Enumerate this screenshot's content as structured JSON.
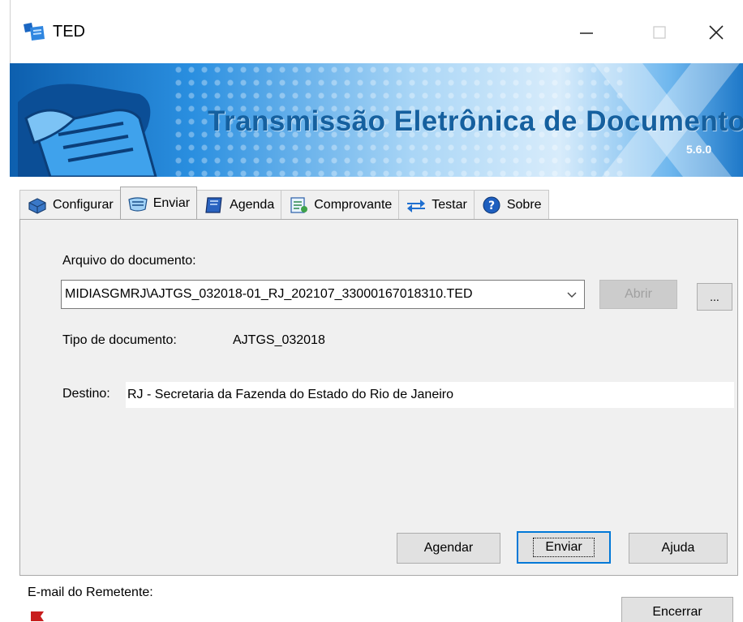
{
  "window": {
    "title": "TED",
    "icon": "ted-app-icon",
    "controls": [
      "minimize-icon",
      "maximize-icon",
      "close-icon"
    ]
  },
  "banner": {
    "title": "Transmissão Eletrônica de Documentos",
    "version": "5.6.0"
  },
  "tabs": [
    {
      "label": "Configurar",
      "icon": "configure-icon",
      "active": false
    },
    {
      "label": "Enviar",
      "icon": "send-icon",
      "active": true
    },
    {
      "label": "Agenda",
      "icon": "agenda-book-icon",
      "active": false
    },
    {
      "label": "Comprovante",
      "icon": "receipt-icon",
      "active": false
    },
    {
      "label": "Testar",
      "icon": "test-arrows-icon",
      "active": false
    },
    {
      "label": "Sobre",
      "icon": "help-icon",
      "active": false
    }
  ],
  "enviar": {
    "file_label": "Arquivo do documento:",
    "file_value": "MIDIASGMRJ\\AJTGS_032018-01_RJ_202107_33000167018310.TED",
    "open_button": "Abrir",
    "browse_button": "...",
    "doc_type_label": "Tipo de documento:",
    "doc_type_value": "AJTGS_032018",
    "destination_label": "Destino:",
    "destination_value": "RJ - Secretaria da Fazenda do Estado do Rio de Janeiro",
    "schedule_button": "Agendar",
    "send_button": "Enviar",
    "help_button": "Ajuda"
  },
  "footer": {
    "sender_email_label": "E-mail do Remetente:",
    "close_button": "Encerrar"
  },
  "colors": {
    "banner_title": "#15609f",
    "focus_border": "#0078d7",
    "panel_bg": "#f0f0f0"
  }
}
